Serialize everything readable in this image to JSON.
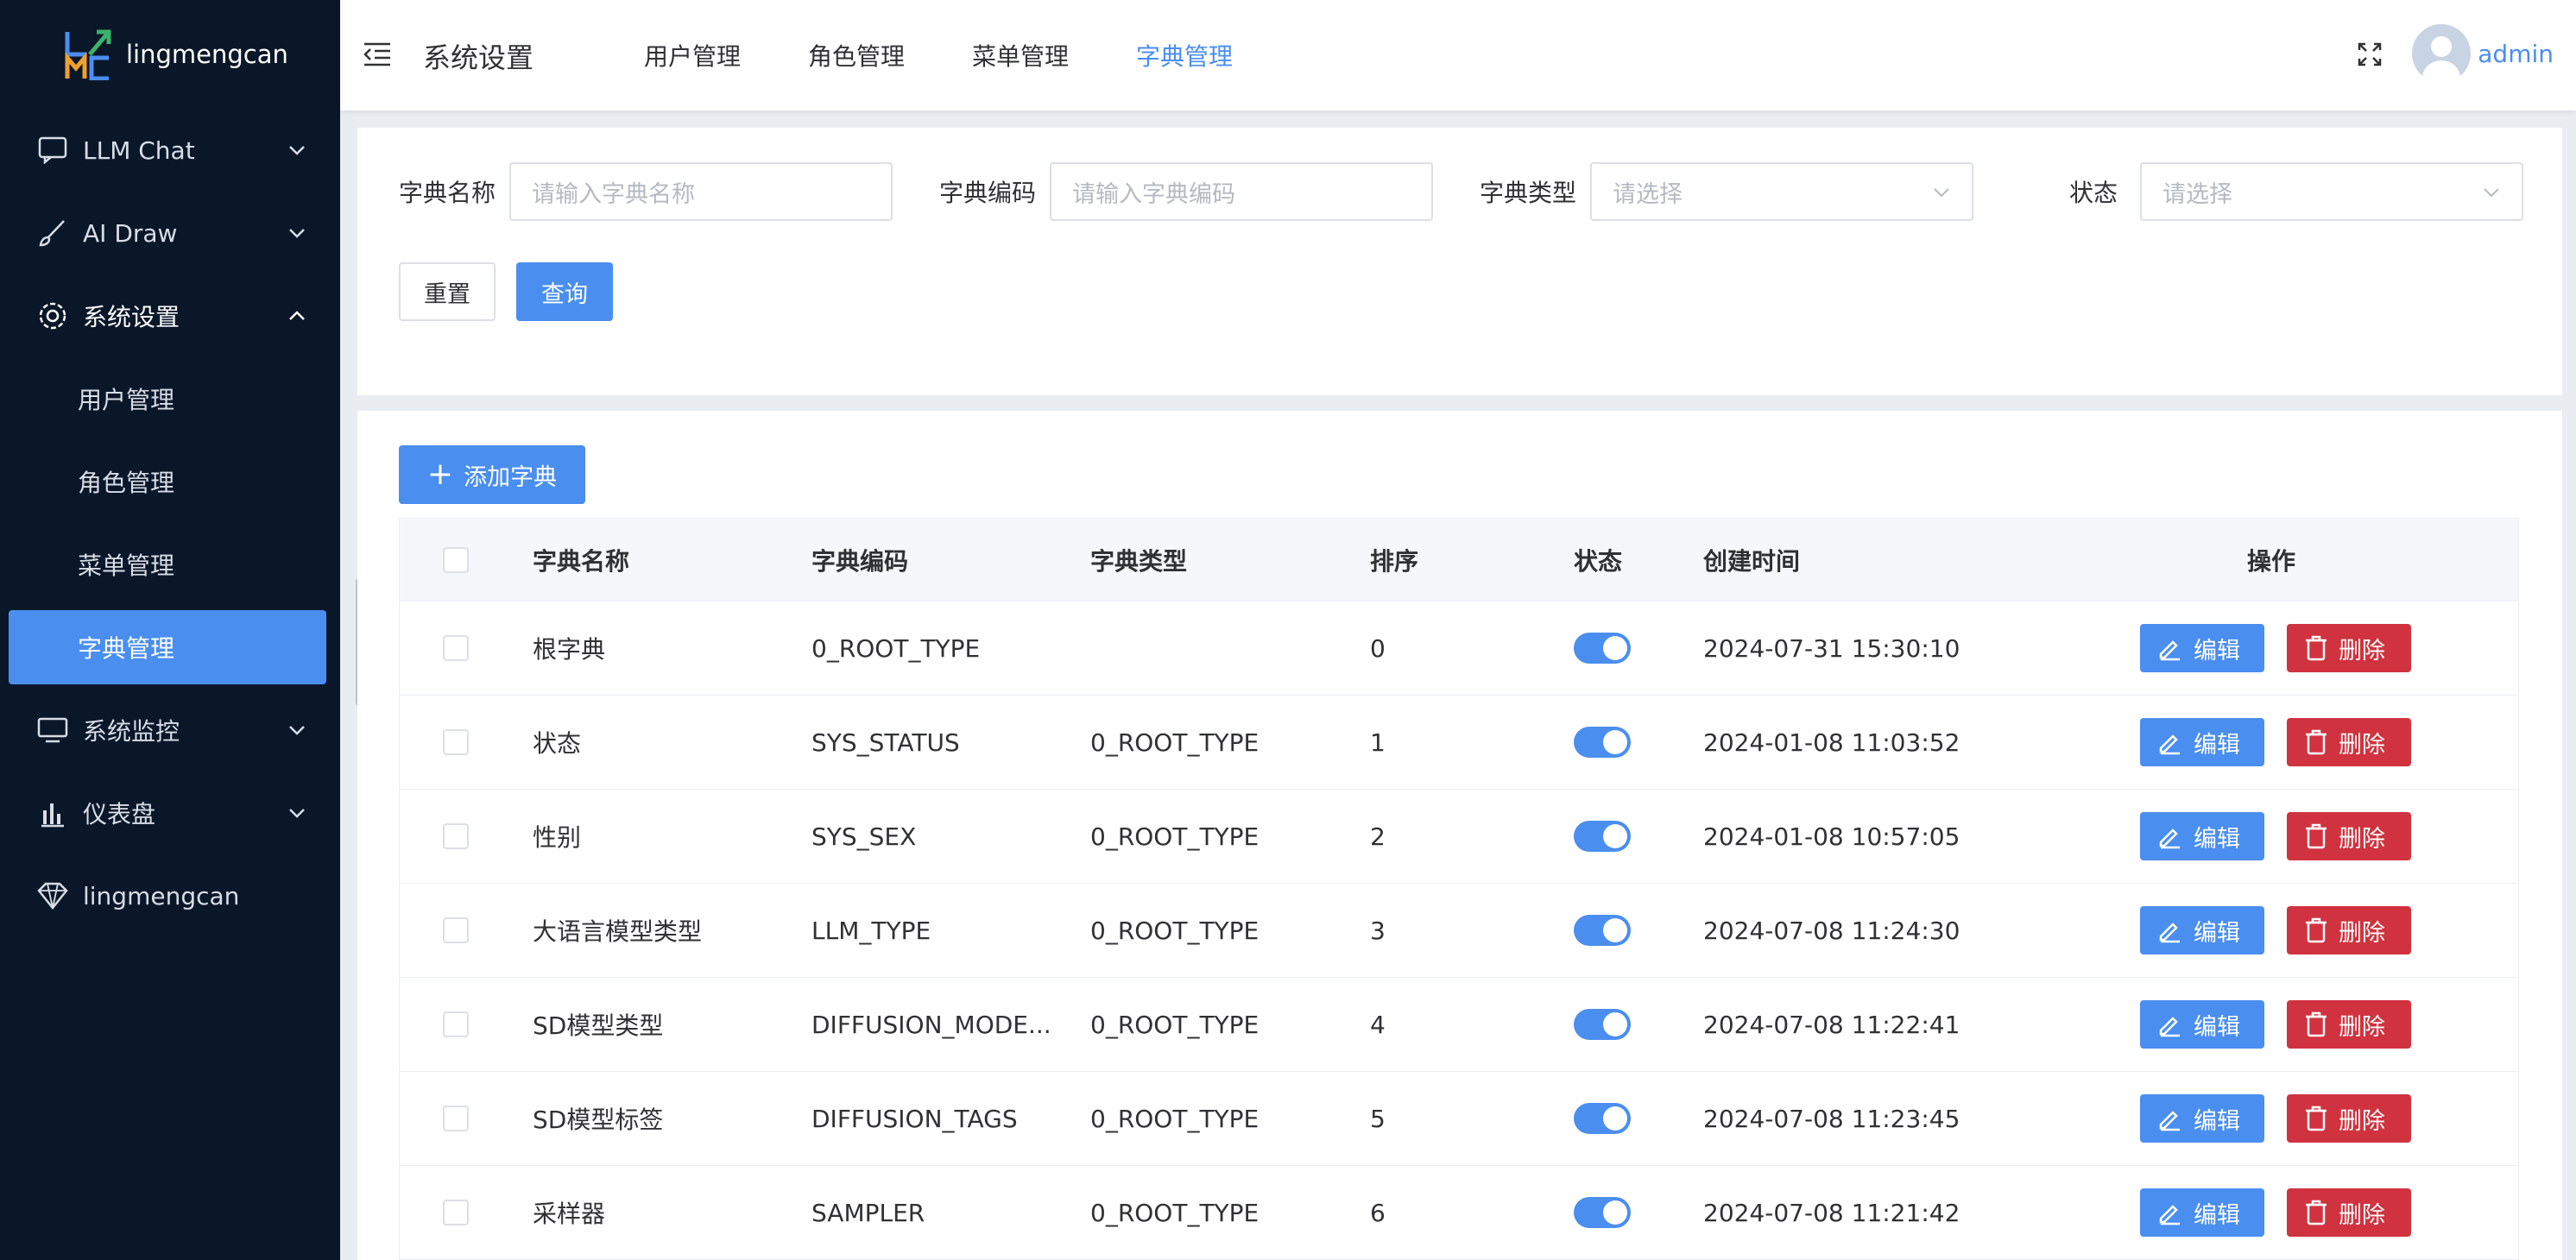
{
  "sidebar": {
    "brand": "lingmengcan",
    "items": [
      {
        "label": "LLM Chat"
      },
      {
        "label": "AI Draw"
      },
      {
        "label": "系统设置"
      },
      {
        "label": "系统监控"
      },
      {
        "label": "仪表盘"
      },
      {
        "label": "lingmengcan"
      }
    ],
    "sub_items": [
      {
        "label": "用户管理"
      },
      {
        "label": "角色管理"
      },
      {
        "label": "菜单管理"
      },
      {
        "label": "字典管理"
      }
    ]
  },
  "header": {
    "title": "系统设置",
    "nav": [
      {
        "label": "用户管理"
      },
      {
        "label": "角色管理"
      },
      {
        "label": "菜单管理"
      },
      {
        "label": "字典管理"
      }
    ],
    "user": "admin"
  },
  "search": {
    "name_label": "字典名称",
    "name_placeholder": "请输入字典名称",
    "code_label": "字典编码",
    "code_placeholder": "请输入字典编码",
    "type_label": "字典类型",
    "type_placeholder": "请选择",
    "status_label": "状态",
    "status_placeholder": "请选择",
    "reset": "重置",
    "query": "查询"
  },
  "table": {
    "add_label": "添加字典",
    "headers": {
      "name": "字典名称",
      "code": "字典编码",
      "type": "字典类型",
      "sort": "排序",
      "status": "状态",
      "time": "创建时间",
      "op": "操作"
    },
    "edit": "编辑",
    "delete": "删除",
    "rows": [
      {
        "name": "根字典",
        "code": "0_ROOT_TYPE",
        "type": "",
        "sort": "0",
        "time": "2024-07-31 15:30:10"
      },
      {
        "name": "状态",
        "code": "SYS_STATUS",
        "type": "0_ROOT_TYPE",
        "sort": "1",
        "time": "2024-01-08 11:03:52"
      },
      {
        "name": "性别",
        "code": "SYS_SEX",
        "type": "0_ROOT_TYPE",
        "sort": "2",
        "time": "2024-01-08 10:57:05"
      },
      {
        "name": "大语言模型类型",
        "code": "LLM_TYPE",
        "type": "0_ROOT_TYPE",
        "sort": "3",
        "time": "2024-07-08 11:24:30"
      },
      {
        "name": "SD模型类型",
        "code": "DIFFUSION_MODE...",
        "type": "0_ROOT_TYPE",
        "sort": "4",
        "time": "2024-07-08 11:22:41"
      },
      {
        "name": "SD模型标签",
        "code": "DIFFUSION_TAGS",
        "type": "0_ROOT_TYPE",
        "sort": "5",
        "time": "2024-07-08 11:23:45"
      },
      {
        "name": "采样器",
        "code": "SAMPLER",
        "type": "0_ROOT_TYPE",
        "sort": "6",
        "time": "2024-07-08 11:21:42"
      }
    ]
  },
  "colors": {
    "sidebar_bg": "#0a1729",
    "accent": "#4a8ef0",
    "danger": "#d0333f"
  }
}
